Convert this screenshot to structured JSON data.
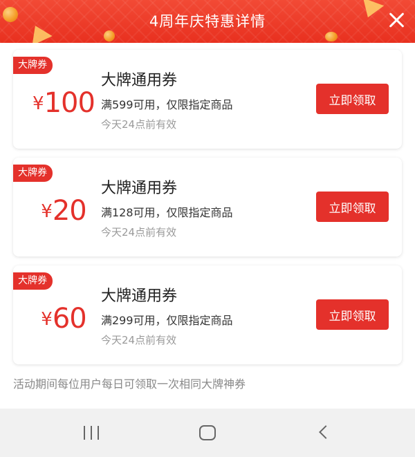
{
  "header": {
    "title": "4周年庆特惠详情"
  },
  "coupons": [
    {
      "tag": "大牌券",
      "currency": "¥",
      "amount": "100",
      "title": "大牌通用券",
      "condition": "满599可用，仅限指定商品",
      "validity": "今天24点前有效",
      "button": "立即领取"
    },
    {
      "tag": "大牌券",
      "currency": "¥",
      "amount": "20",
      "title": "大牌通用券",
      "condition": "满128可用，仅限指定商品",
      "validity": "今天24点前有效",
      "button": "立即领取"
    },
    {
      "tag": "大牌券",
      "currency": "¥",
      "amount": "60",
      "title": "大牌通用券",
      "condition": "满299可用，仅限指定商品",
      "validity": "今天24点前有效",
      "button": "立即领取"
    }
  ],
  "footnote": "活动期间每位用户每日可领取一次相同大牌神券",
  "colors": {
    "accent": "#e4312b",
    "header": "#ee3b27",
    "muted_text": "#9a9a9a",
    "navbar": "#f1f1f1"
  },
  "icons": {
    "close": "close-icon",
    "recent_apps": "recent-apps-icon",
    "home": "home-icon",
    "back": "back-icon"
  }
}
